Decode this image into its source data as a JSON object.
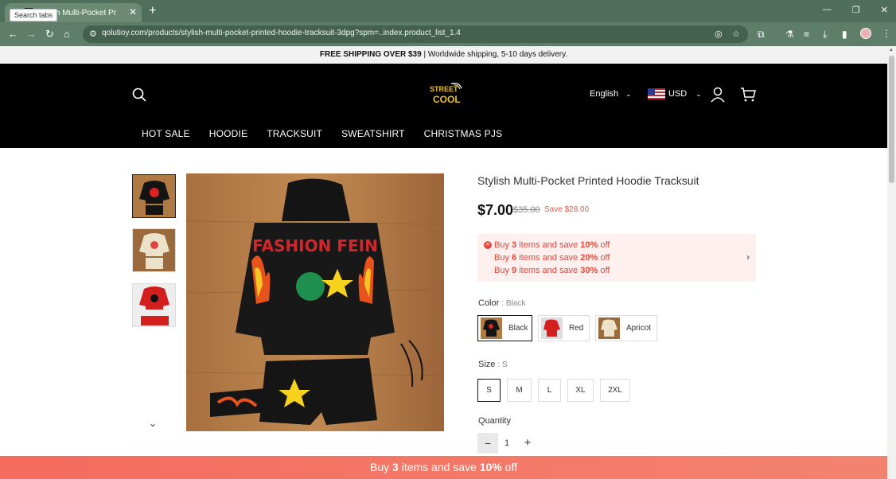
{
  "browser": {
    "tab_title": "Stylish Multi-Pocket Printed Ho...",
    "tooltip": "Search tabs",
    "url": "qolutioy.com/products/stylish-multi-pocket-printed-hoodie-tracksuit-3dpg?spm=..index.product_list_1.4"
  },
  "announcement": {
    "bold": "FREE SHIPPING OVER $39",
    "rest": " | Worldwide shipping, 5-10 days delivery."
  },
  "header": {
    "language": "English",
    "currency": "USD",
    "logo_line1": "STREET",
    "logo_line2": "COOL"
  },
  "nav": [
    "HOT SALE",
    "HOODIE",
    "TRACKSUIT",
    "SWEATSHIRT",
    "CHRISTMAS PJS"
  ],
  "product": {
    "title": "Stylish Multi-Pocket Printed Hoodie Tracksuit",
    "price": "$7.00",
    "old_price": "$35.00",
    "save": "Save $28.00",
    "print_text": "FASHION FEIN"
  },
  "promos": [
    {
      "pre": "Buy ",
      "qty": "3",
      "mid": " items and save ",
      "pct": "10%",
      "post": " off"
    },
    {
      "pre": "Buy ",
      "qty": "6",
      "mid": " items and save ",
      "pct": "20%",
      "post": " off"
    },
    {
      "pre": "Buy ",
      "qty": "9",
      "mid": " items and save ",
      "pct": "30%",
      "post": " off"
    }
  ],
  "color": {
    "label": "Color",
    "selected": ": Black",
    "options": [
      "Black",
      "Red",
      "Apricot"
    ]
  },
  "size": {
    "label": "Size",
    "selected": ": S",
    "options": [
      "S",
      "M",
      "L",
      "XL",
      "2XL"
    ]
  },
  "quantity": {
    "label": "Quantity",
    "value": "1"
  },
  "bottom_bar": {
    "pre": "Buy ",
    "qty": "3",
    "mid": " items and save ",
    "pct": "10%",
    "post": " off"
  },
  "colors": {
    "header_bg": "#000000",
    "accent": "#e2483c",
    "promo_bg": "#fdf0ee",
    "browser": "#4f6f5c"
  }
}
